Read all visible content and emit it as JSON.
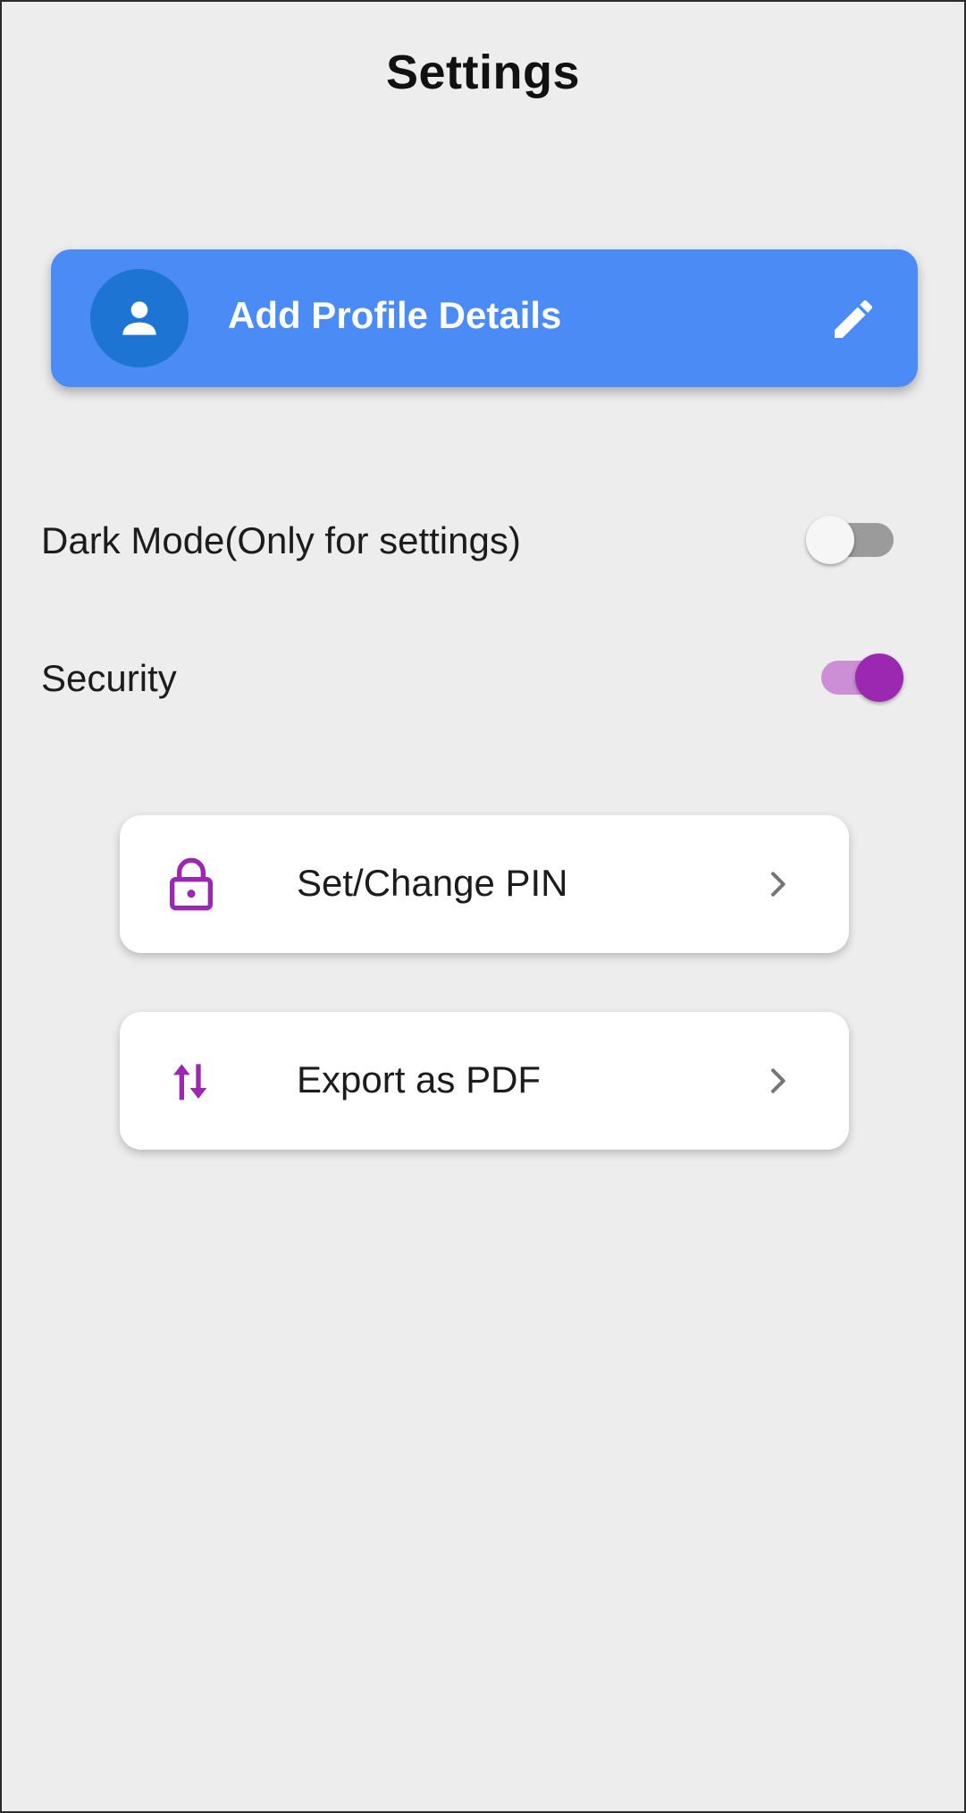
{
  "header": {
    "title": "Settings"
  },
  "profile": {
    "label": "Add Profile Details",
    "avatar_icon": "person-icon",
    "edit_icon": "pencil-icon",
    "card_color": "#4a8bf5",
    "avatar_color": "#1e74d2"
  },
  "settings": {
    "dark_mode": {
      "label": "Dark Mode(Only for settings)",
      "enabled": false
    },
    "security": {
      "label": "Security",
      "enabled": true
    }
  },
  "menu": {
    "items": [
      {
        "label": "Set/Change PIN",
        "icon": "lock-icon"
      },
      {
        "label": "Export as PDF",
        "icon": "swap-vertical-icon"
      }
    ]
  },
  "colors": {
    "accent": "#9c27b0",
    "background": "#ededed"
  }
}
